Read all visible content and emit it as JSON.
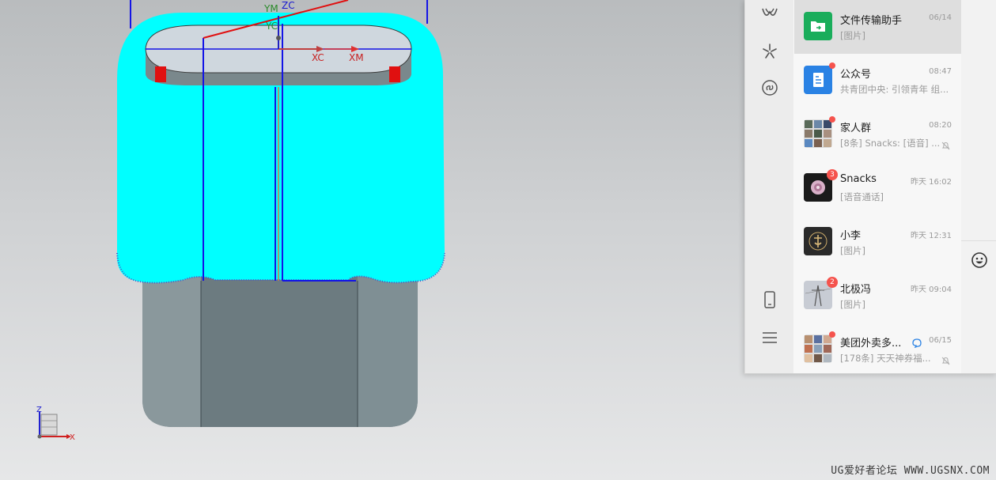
{
  "cad": {
    "labels": {
      "xc": "XC",
      "xm": "XM",
      "zc": "ZC",
      "ym": "YM",
      "yc": "YC"
    },
    "triad": {
      "z": "Z",
      "x": "X"
    },
    "colors": {
      "cyan_face": "#00ffff",
      "body_gray": "#6c7b80",
      "edge_blue": "#1414e6",
      "axis_red": "#e01010"
    }
  },
  "wechat": {
    "rail_icons": [
      "look-icon",
      "moments-icon",
      "mini-program-icon",
      "phone-icon",
      "menu-icon"
    ],
    "chats": [
      {
        "name": "文件传输助手",
        "time": "06/14",
        "preview": "[图片]",
        "avatar": "file-transfer-icon",
        "active": true
      },
      {
        "name": "公众号",
        "time": "08:47",
        "preview": "共青团中央: 引领青年 组...",
        "avatar": "official-accounts-icon",
        "dot": true
      },
      {
        "name": "家人群",
        "time": "08:20",
        "preview": "[8条] Snacks: [语音] ...",
        "avatar": "group-avatar",
        "dot": true,
        "muted": true
      },
      {
        "name": "Snacks",
        "time": "昨天 16:02",
        "preview": "[语音通话]",
        "avatar": "flower-avatar",
        "count": "3"
      },
      {
        "name": "小李",
        "time": "昨天 12:31",
        "preview": "[图片]",
        "avatar": "calligraphy-avatar"
      },
      {
        "name": "北极冯",
        "time": "昨天 09:04",
        "preview": "[图片]",
        "avatar": "powerline-avatar",
        "count": "2"
      },
      {
        "name": "美团外卖多...",
        "time": "06/15",
        "preview": "[178条] 天天神券福...",
        "avatar": "group-avatar-2",
        "dot": true,
        "muted": true
      }
    ],
    "emoji_icon": "emoji-icon"
  },
  "watermark": "UG爱好者论坛 WWW.UGSNX.COM"
}
